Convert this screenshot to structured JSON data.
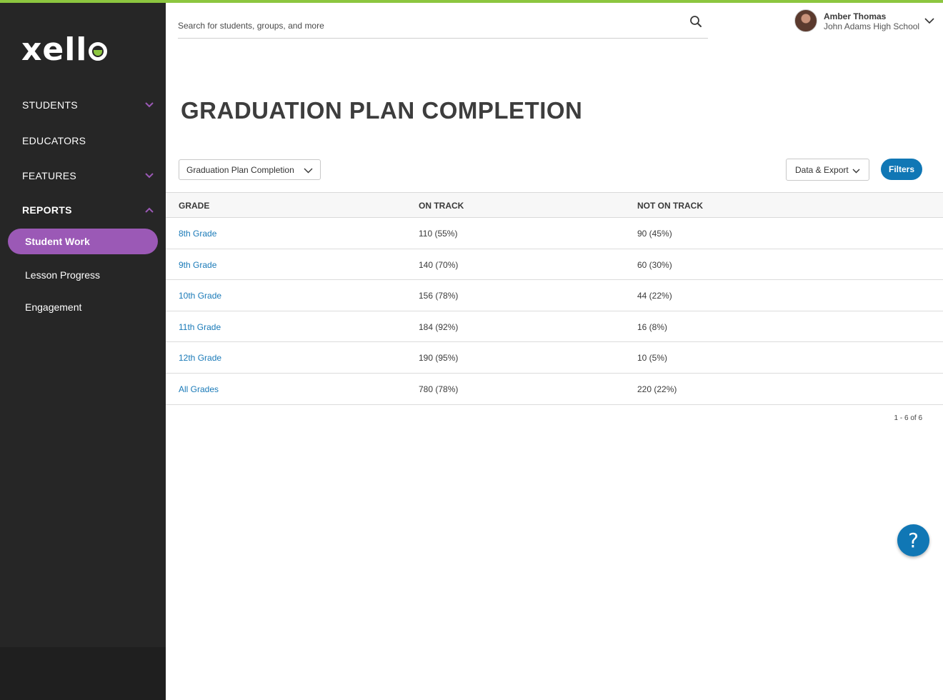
{
  "brand": {
    "logo_text": "xell",
    "accent": "#8cc63f",
    "sidebar_bg": "#262626",
    "active_color": "#9b59b6",
    "link_color": "#1a7ab8",
    "button_color": "#1077b5"
  },
  "sidebar": {
    "items": [
      {
        "label": "STUDENTS",
        "chevron": "down"
      },
      {
        "label": "EDUCATORS",
        "chevron": ""
      },
      {
        "label": "FEATURES",
        "chevron": "down"
      },
      {
        "label": "REPORTS",
        "chevron": "up"
      }
    ],
    "reports_sub": [
      {
        "label": "Student Work",
        "active": true
      },
      {
        "label": "Lesson Progress",
        "active": false
      },
      {
        "label": "Engagement",
        "active": false
      }
    ]
  },
  "search": {
    "placeholder": "Search for students, groups, and more",
    "value": ""
  },
  "user": {
    "name": "Amber Thomas",
    "school": "John Adams High School"
  },
  "page": {
    "title": "GRADUATION PLAN COMPLETION"
  },
  "toolbar": {
    "report_select": "Graduation Plan Completion",
    "export_label": "Data & Export",
    "filters_label": "Filters"
  },
  "table": {
    "headers": [
      "GRADE",
      "ON TRACK",
      "NOT ON TRACK"
    ],
    "rows": [
      [
        "8th Grade",
        "110 (55%)",
        "90 (45%)"
      ],
      [
        "9th Grade",
        "140 (70%)",
        "60 (30%)"
      ],
      [
        "10th Grade",
        "156 (78%)",
        "44 (22%)"
      ],
      [
        "11th Grade",
        "184 (92%)",
        "16 (8%)"
      ],
      [
        "12th Grade",
        "190 (95%)",
        "10 (5%)"
      ],
      [
        "All Grades",
        "780 (78%)",
        "220 (22%)"
      ]
    ]
  },
  "pager": {
    "text": "1 - 6 of 6"
  },
  "help": {
    "label": "?"
  }
}
